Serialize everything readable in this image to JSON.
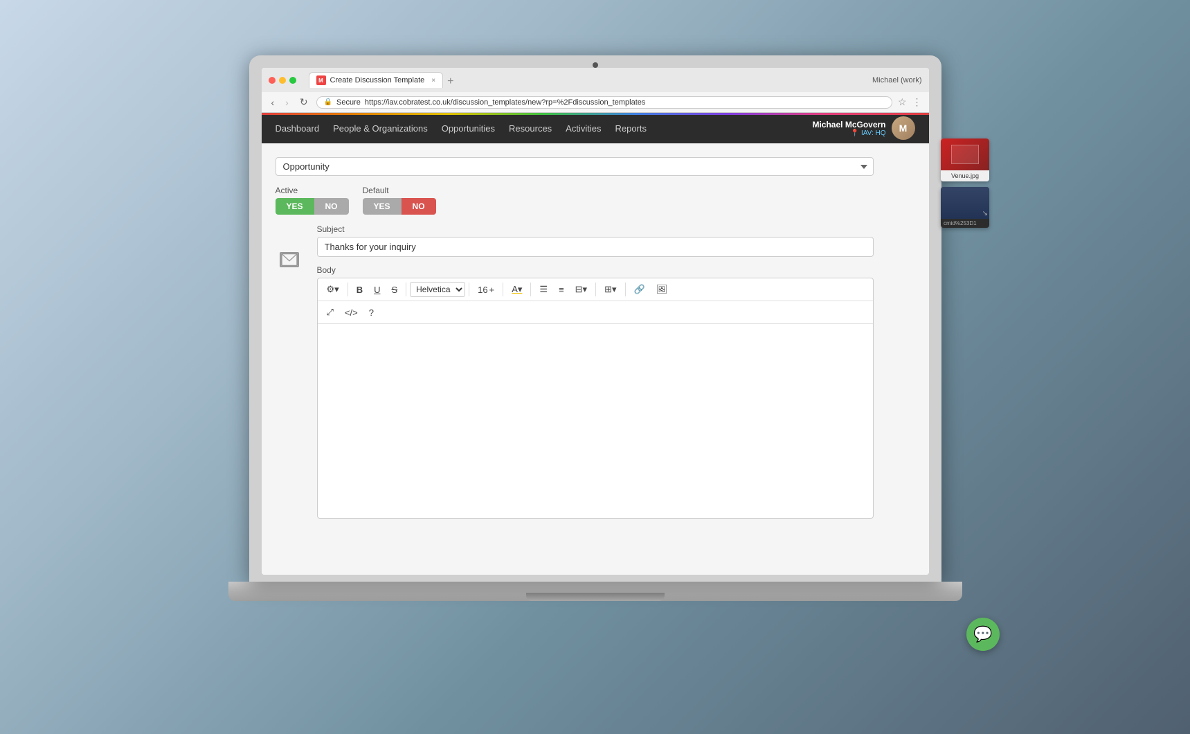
{
  "browser": {
    "user_label": "Michael (work)",
    "tab_label": "Create Discussion Template",
    "tab_favicon": "M",
    "url": "https://iav.cobratest.co.uk/discussion_templates/new?rp=%2Fdiscussion_templates",
    "secure_text": "Secure"
  },
  "navbar": {
    "links": [
      {
        "label": "Dashboard",
        "name": "dashboard"
      },
      {
        "label": "People & Organizations",
        "name": "people-organizations"
      },
      {
        "label": "Opportunities",
        "name": "opportunities"
      },
      {
        "label": "Resources",
        "name": "resources"
      },
      {
        "label": "Activities",
        "name": "activities"
      },
      {
        "label": "Reports",
        "name": "reports"
      }
    ],
    "user_name": "Michael McGovern",
    "user_location": "IAV: HQ"
  },
  "page": {
    "title": "Create Discussion Template"
  },
  "form": {
    "type_label": "Opportunity",
    "active_label": "Active",
    "active_yes": "YES",
    "active_no": "NO",
    "default_label": "Default",
    "default_yes": "YES",
    "default_no": "NO",
    "subject_label": "Subject",
    "subject_value": "Thanks for your inquiry",
    "body_label": "Body",
    "font_family": "Helvetica",
    "font_size": "16",
    "toolbar_buttons": [
      {
        "icon": "⚙",
        "label": "magic"
      },
      {
        "icon": "B",
        "label": "bold"
      },
      {
        "icon": "U",
        "label": "underline"
      },
      {
        "icon": "✕",
        "label": "strike"
      },
      {
        "icon": "Helvetica ▾",
        "label": "font"
      },
      {
        "icon": "16",
        "label": "size"
      },
      {
        "icon": "A",
        "label": "font-color"
      },
      {
        "icon": "≡",
        "label": "ul"
      },
      {
        "icon": "≡",
        "label": "ol"
      },
      {
        "icon": "≡",
        "label": "align"
      },
      {
        "icon": "⊞",
        "label": "table"
      },
      {
        "icon": "🔗",
        "label": "link"
      },
      {
        "icon": "🖼",
        "label": "image"
      }
    ],
    "toolbar2_buttons": [
      {
        "icon": "✕✕",
        "label": "expand"
      },
      {
        "icon": "</>",
        "label": "code"
      },
      {
        "icon": "?",
        "label": "help"
      }
    ]
  },
  "side_panel": {
    "venue_label": "Venue.jpg",
    "other_label": "cmid%253D1"
  },
  "chat_btn": {
    "icon": "💬"
  }
}
